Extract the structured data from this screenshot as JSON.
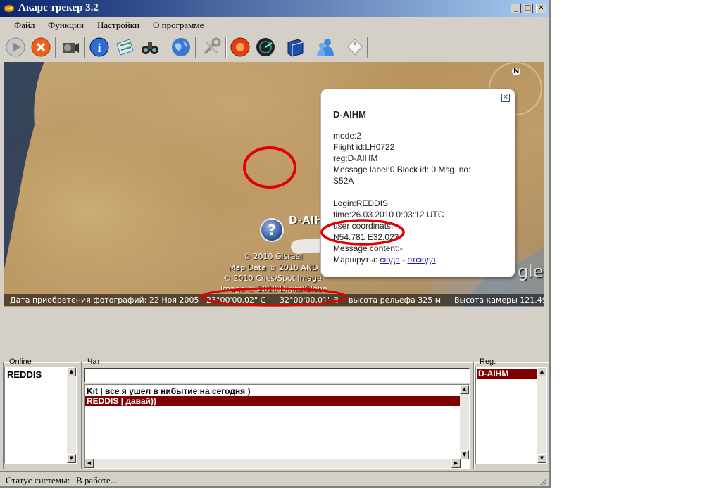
{
  "window": {
    "title": "Акарс трекер 3.2",
    "controls": {
      "minimize": "_",
      "maximize": "□",
      "close": "✕"
    }
  },
  "menu": [
    "Файл",
    "Функции",
    "Настройки",
    "О программе"
  ],
  "toolbar": {
    "buttons": [
      "play-icon",
      "stop-icon",
      "camera-icon",
      "info-icon",
      "map-icon",
      "binoculars-icon",
      "globe-icon",
      "tools-icon",
      "alarm-icon",
      "radar-icon",
      "book-icon",
      "users-icon",
      "tag-icon"
    ]
  },
  "map": {
    "compass": "N",
    "attribution": [
      "© 2010 Gisrael",
      "Map Data © 2010 AND",
      "© 2010 Cnes/Spot Image",
      "Image © 2010 DigitalGlobe"
    ],
    "logo_fragment": "gle",
    "status": {
      "photo_date": "Дата приобретения фотографий: 22 Ноя 2005",
      "lat": "23°00'00.02\" С",
      "lon": "32°00'00.01\" В",
      "elevation": "высота рельефа  325 м",
      "camera": "Высота камеры    121.49"
    },
    "aircraft_label": "D-AIHM",
    "aircraft_marker": "?"
  },
  "popup": {
    "close": "✕",
    "title": "D-AIHM",
    "lines": {
      "mode": "mode:2",
      "flight": "Flight id:LH0722",
      "reg": "reg:D-AIHM",
      "label1": "Message label:0 Block id: 0 Msg. no:",
      "label2": "S52A",
      "login": "Login:REDDIS",
      "time": "time:26.03.2010 0:03:12 UTC",
      "user_coords_label": "user coordinats:",
      "user_coords": "N54.781 E32.023",
      "message": "Message content:-",
      "routes_label": "Маршруты:",
      "route_to": "сюда",
      "route_sep": " - ",
      "route_from": "отсюда"
    }
  },
  "panels": {
    "online": {
      "legend": "Online",
      "items": [
        "REDDIS"
      ]
    },
    "chat": {
      "legend": "Чат",
      "input_value": "",
      "messages": [
        "Kit | все я ушел в нибытие на сегодня )",
        "REDDIS | давай))"
      ]
    },
    "reg": {
      "legend": "Reg.",
      "items": [
        "D-AIHM"
      ]
    }
  },
  "statusbar": {
    "label": "Статус системы:",
    "value": "В работе..."
  },
  "annotation_color": "#e00000"
}
